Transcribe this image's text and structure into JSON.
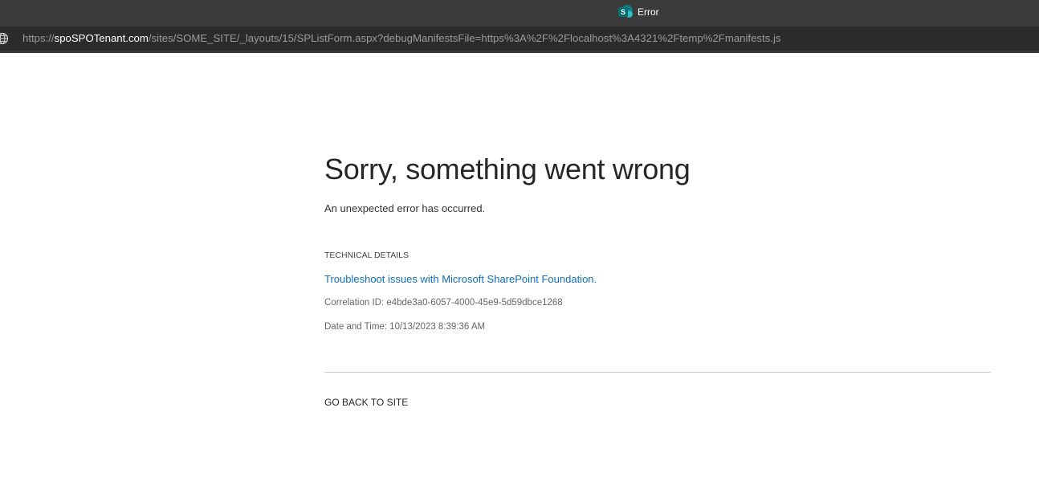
{
  "browser": {
    "tab_title": "Error",
    "url_prefix": "https://",
    "url_host": "spoSPOTenant.com",
    "url_path": "/sites/SOME_SITE/_layouts/15/SPListForm.aspx?debugManifestsFile=https%3A%2F%2Flocalhost%3A4321%2Ftemp%2Fmanifests.js",
    "favicon": "sharepoint-icon",
    "favicon_letter": "S",
    "site_info_icon": "globe-icon"
  },
  "error_page": {
    "heading": "Sorry, something went wrong",
    "subtitle": "An unexpected error has occurred.",
    "technical_details_label": "TECHNICAL DETAILS",
    "troubleshoot_link": "Troubleshoot issues with Microsoft SharePoint Foundation.",
    "correlation_id": "Correlation ID: e4bde3a0-6057-4000-45e9-5d59dbce1268",
    "date_time": "Date and Time: 10/13/2023 8:39:36 AM",
    "go_back_link": "GO BACK TO SITE"
  },
  "colors": {
    "link": "#0f6cbd",
    "titlebar": "#3b3b3b",
    "addressbar": "#2b2b2b"
  }
}
